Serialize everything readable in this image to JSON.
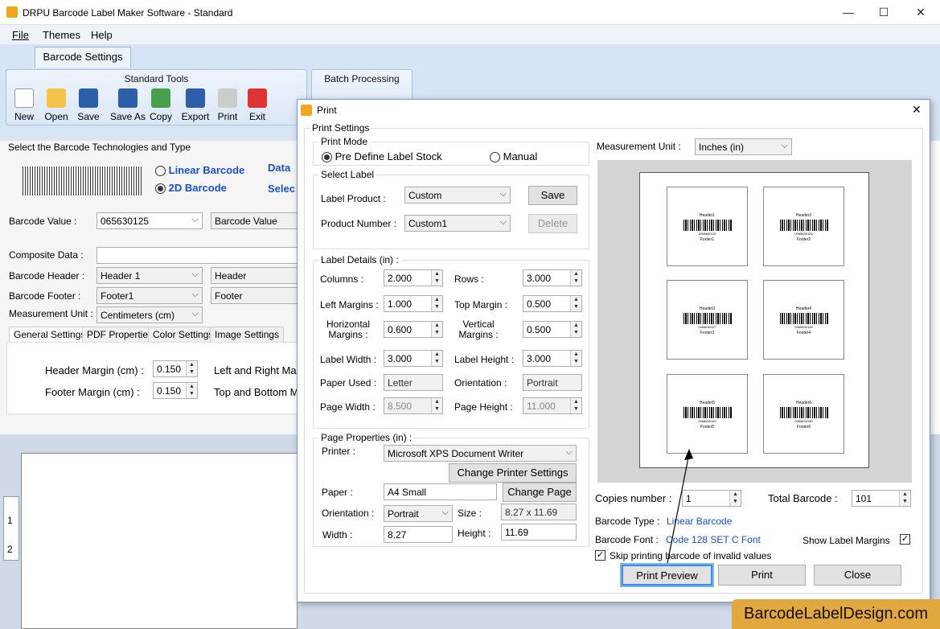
{
  "window": {
    "title": "DRPU Barcode Label Maker Software - Standard",
    "minimize": "—",
    "maximize": "☐",
    "close": "✕"
  },
  "menu": {
    "file": "File",
    "themes": "Themes",
    "help": "Help"
  },
  "ribbon": {
    "tab": "Barcode Settings",
    "standard_tools": "Standard Tools",
    "batch_processing": "Batch Processing",
    "tools": [
      {
        "label": "New"
      },
      {
        "label": "Open"
      },
      {
        "label": "Save"
      },
      {
        "label": "Save As"
      },
      {
        "label": "Copy"
      },
      {
        "label": "Export"
      },
      {
        "label": "Print"
      },
      {
        "label": "Exit"
      }
    ]
  },
  "main": {
    "tech_title": "Select the Barcode Technologies and Type",
    "linear": "Linear Barcode",
    "twod": "2D Barcode",
    "data_src": "Data",
    "select": "Selec",
    "barcode_value_label": "Barcode Value :",
    "barcode_value": "065630125",
    "barcode_value_combo": "Barcode Value",
    "composite_label": "Composite Data :",
    "header_label": "Barcode Header :",
    "header_value": "Header 1",
    "header_combo": "Header",
    "footer_label": "Barcode Footer :",
    "footer_value": "Footer1",
    "footer_combo": "Footer",
    "unit_label": "Measurement Unit :",
    "unit_value": "Centimeters (cm)",
    "tabs": [
      "General Settings",
      "PDF Properties",
      "Color Settings",
      "Image Settings"
    ],
    "header_margin_label": "Header Margin (cm) :",
    "header_margin": "0.150",
    "footer_margin_label": "Footer Margin (cm) :",
    "footer_margin": "0.150",
    "lr_margin_label": "Left and Right Mar",
    "tb_margin_label": "Top and Bottom M",
    "ruler": [
      "1",
      "2"
    ]
  },
  "dialog": {
    "title": "Print",
    "close": "✕",
    "print_settings": "Print Settings",
    "print_mode": "Print Mode",
    "predefine": "Pre Define Label Stock",
    "manual": "Manual",
    "select_label": "Select Label",
    "label_product_label": "Label Product :",
    "label_product": "Custom",
    "save": "Save",
    "product_number_label": "Product Number :",
    "product_number": "Custom1",
    "delete": "Delete",
    "label_details": "Label Details (in) :",
    "columns_label": "Columns :",
    "columns": "2.000",
    "rows_label": "Rows :",
    "rows": "3.000",
    "left_margins_label": "Left Margins :",
    "left_margins": "1.000",
    "top_margin_label": "Top Margin :",
    "top_margin": "0.500",
    "hmargins_label": "Horizontal Margins :",
    "hmargins": "0.600",
    "vmargins_label": "Vertical Margins :",
    "vmargins": "0.500",
    "label_width_label": "Label Width :",
    "label_width": "3.000",
    "label_height_label": "Label Height :",
    "label_height": "3.000",
    "paper_used_label": "Paper Used :",
    "paper_used": "Letter",
    "orientation_label": "Orientation :",
    "orientation": "Portrait",
    "page_width_label": "Page Width :",
    "page_width": "8.500",
    "page_height_label": "Page Height :",
    "page_height": "11.000",
    "page_properties": "Page Properties (in) :",
    "printer_label": "Printer :",
    "printer": "Microsoft XPS Document Writer",
    "change_printer": "Change Printer Settings",
    "paper_label": "Paper :",
    "paper": "A4 Small",
    "change_page": "Change Page",
    "orient2_label": "Orientation :",
    "orient2": "Portrait",
    "size_label": "Size :",
    "size": "8.27 x 11.69",
    "width_label": "Width :",
    "width": "8.27",
    "height_label": "Height :",
    "height": "11.69",
    "measurement_unit_label": "Measurement Unit :",
    "measurement_unit": "Inches (in)",
    "copies_label": "Copies number :",
    "copies": "1",
    "total_label": "Total Barcode :",
    "total": "101",
    "barcode_type_label": "Barcode Type :",
    "barcode_type": "Linear Barcode",
    "barcode_font_label": "Barcode Font :",
    "barcode_font": "Code 128 SET C Font",
    "show_margins": "Show Label Margins",
    "skip_invalid": "Skip printing barcode of invalid values",
    "print_preview": "Print Preview",
    "print": "Print",
    "close_btn": "Close",
    "preview_labels": [
      {
        "header": "Header1",
        "number": "006563012I",
        "footer": "Footer1"
      },
      {
        "header": "Header2",
        "number": "0065630126",
        "footer": "Footer2"
      },
      {
        "header": "Header3",
        "number": "0065630127",
        "footer": "Footer3"
      },
      {
        "header": "Header4",
        "number": "0065630128",
        "footer": "Footer4"
      },
      {
        "header": "Header5",
        "number": "0065630129",
        "footer": "Footer5"
      },
      {
        "header": "Header6",
        "number": "0065630130",
        "footer": "Footer6"
      }
    ]
  },
  "watermark": "BarcodeLabelDesign.com"
}
